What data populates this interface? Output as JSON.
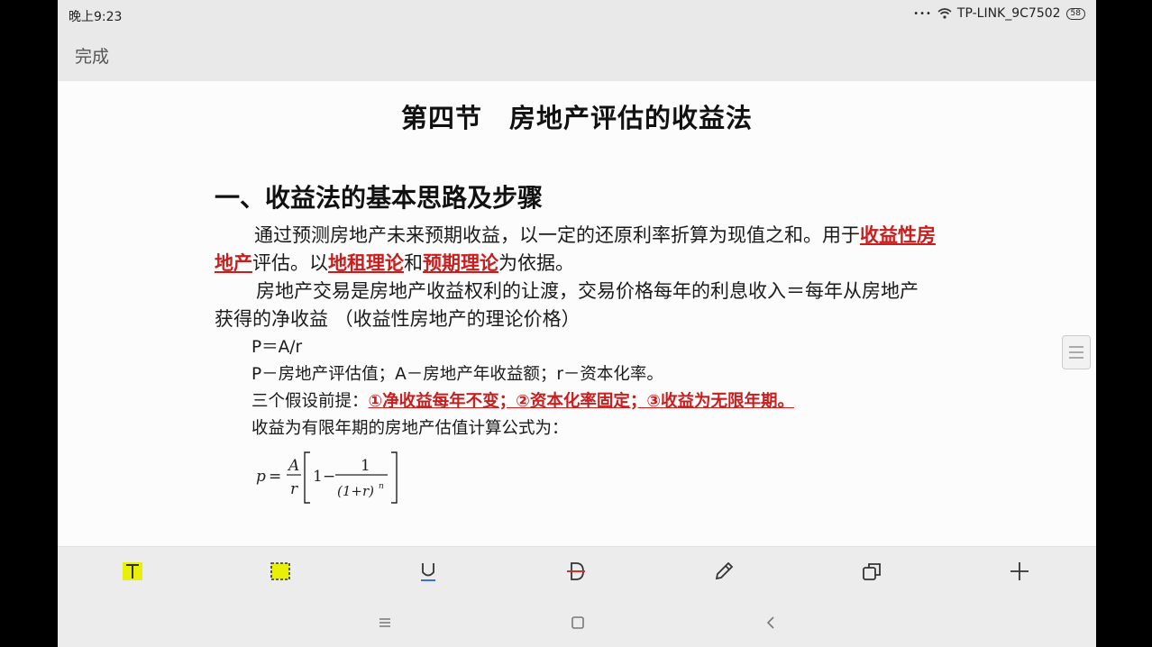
{
  "status": {
    "time": "晚上9:23",
    "network": "TP-LINK_9C7502",
    "battery": "58",
    "dots": "•••"
  },
  "topbar": {
    "done_label": "完成"
  },
  "document": {
    "title": "第四节　房地产评估的收益法",
    "section_heading": "一、收益法的基本思路及步骤",
    "para1": {
      "t1": "通过预测房地产未来预期收益，以一定的还原利率折算为现值之和。用于",
      "h1": "收益性房地产",
      "t2": "评估。以",
      "h2": "地租理论",
      "t3": "和",
      "h3": "预期理论",
      "t4": "为依据。"
    },
    "para2": "房地产交易是房地产收益权利的让渡，交易价格每年的利息收入＝每年从房地产获得的净收益 （收益性房地产的理论价格）",
    "formula_line": "P＝A/r",
    "definitions": "P－房地产评估值；A－房地产年收益额；r－资本化率。",
    "assumptions_label": "三个假设前提：",
    "assumptions": "①净收益每年不变；②资本化率固定；③收益为无限年期。",
    "finite_label": "收益为有限年期的房地产估值计算公式为：",
    "formula": {
      "p": "p",
      "eq": "=",
      "A": "A",
      "r": "r",
      "one": "1",
      "minus": "−",
      "denom": "(1+r)",
      "n": "n"
    }
  },
  "toolbar": [
    "text-tool-icon",
    "select-tool-icon",
    "underline-tool-icon",
    "strikethrough-tool-icon",
    "pencil-tool-icon",
    "copy-tool-icon",
    "add-tool-icon"
  ],
  "colors": {
    "highlight": "#c81e1e",
    "tool_yellow": "#e8f00a",
    "underline_blue": "#3a6fd8"
  }
}
